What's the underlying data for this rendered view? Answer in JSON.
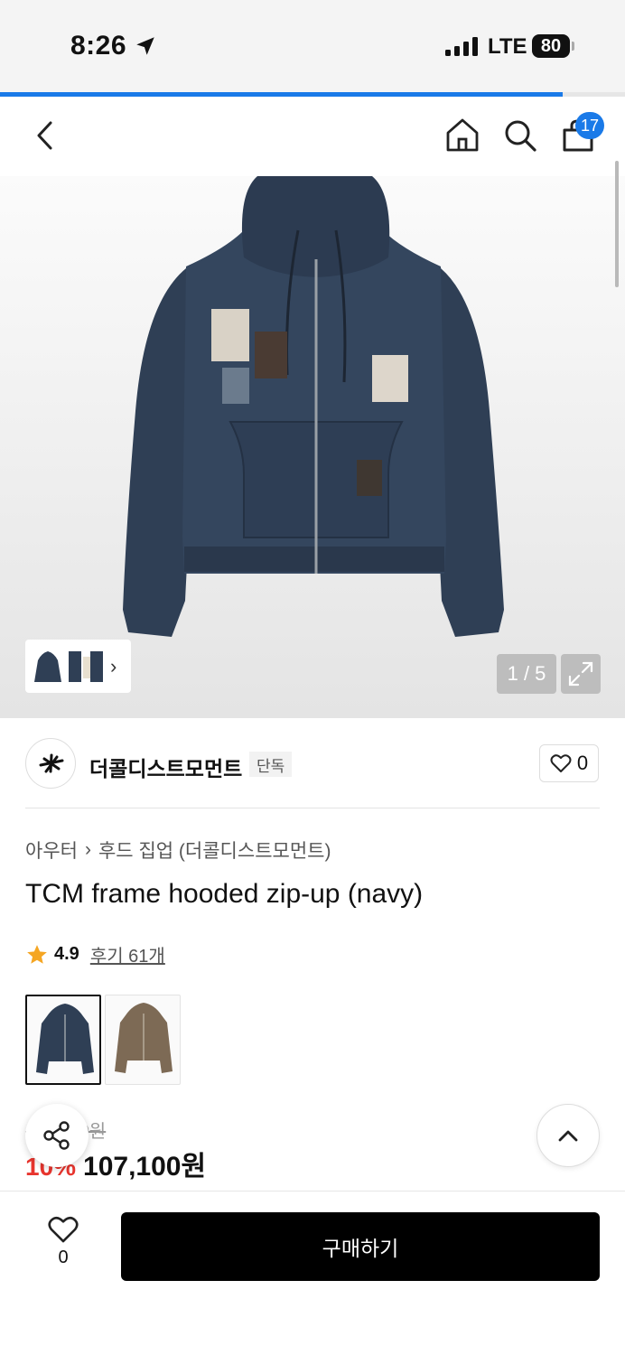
{
  "status_bar": {
    "time": "8:26",
    "network": "LTE",
    "battery": "80",
    "loading_progress": 0.9
  },
  "nav": {
    "cart_count": "17"
  },
  "gallery": {
    "counter": "1 / 5"
  },
  "brand": {
    "name": "더콜디스트모먼트",
    "tag": "단독",
    "like_count": "0"
  },
  "breadcrumb": {
    "category": "아우터",
    "subcategory": "후드 집업 (더콜디스트모먼트)"
  },
  "product": {
    "title": "TCM frame hooded zip-up (navy)",
    "rating": "4.9",
    "reviews": "후기 61개",
    "color_options": [
      "navy",
      "brown"
    ],
    "original_price": "119,000원",
    "discount": "10%",
    "price": "107,100원"
  },
  "bottom_bar": {
    "wish_count": "0",
    "buy_label": "구매하기"
  },
  "colors": {
    "accent": "#1a7ae8",
    "discount": "#e8352e",
    "navy": "#2f3f55",
    "brown": "#7d6a55"
  }
}
